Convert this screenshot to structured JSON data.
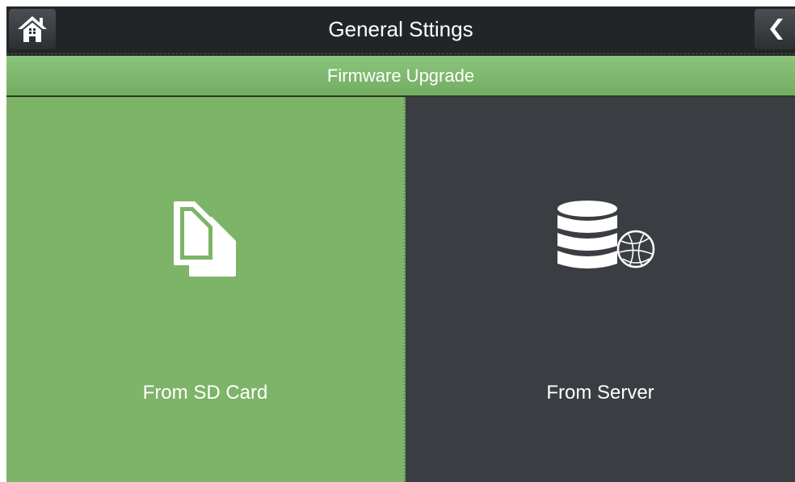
{
  "header": {
    "title": "General Sttings",
    "home_icon": "home-icon",
    "back_icon": "chevron-left-icon"
  },
  "subheader": {
    "title": "Firmware Upgrade"
  },
  "options": [
    {
      "label": "From SD Card",
      "icon": "sd-card-icon",
      "color": "#7db468"
    },
    {
      "label": "From Server",
      "icon": "server-globe-icon",
      "color": "#3a3d41"
    }
  ],
  "colors": {
    "accent_green": "#7db468",
    "dark_panel": "#3a3d41",
    "topbar": "#222528"
  }
}
